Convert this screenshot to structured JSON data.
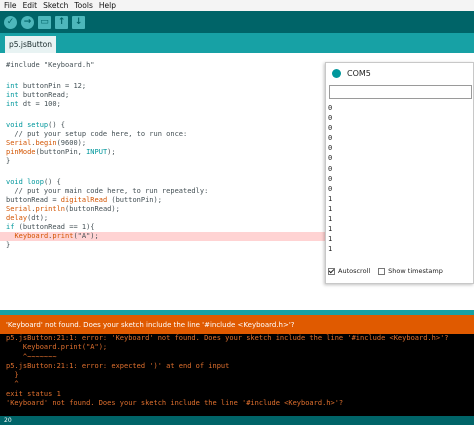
{
  "menu": [
    "File",
    "Edit",
    "Sketch",
    "Tools",
    "Help"
  ],
  "toolbar": {
    "verify": "✓",
    "upload": "→",
    "new": "▭",
    "open": "↑",
    "save": "↓"
  },
  "tab": {
    "label": "p5.jsButton"
  },
  "code": {
    "l1": "#include \"Keyboard.h\"",
    "l2_kw": "int",
    "l2": " buttonPin = 12;",
    "l3_kw": "int",
    "l3": " buttonRead;",
    "l4_kw": "int",
    "l4": " dt = 100;",
    "l5_kw": "void",
    "l5_fn": " setup",
    "l5": "() {",
    "l6": "  // put your setup code here, to run once:",
    "l7_fn": "Serial",
    "l7_a": ".",
    "l7_fn2": "begin",
    "l7": "(9600);",
    "l8_fn": "pinMode",
    "l8": "(buttonPin, ",
    "l8_kw": "INPUT",
    "l8_b": ");",
    "l9": "}",
    "l10_kw": "void",
    "l10_fn": " loop",
    "l10": "() {",
    "l11": "  // put your main code here, to run repeatedly:",
    "l12": "buttonRead = ",
    "l12_fn": "digitalRead",
    "l12_b": " (buttonPin);",
    "l13_fn": "Serial",
    "l13_a": ".",
    "l13_fn2": "println",
    "l13": "(buttonRead);",
    "l14_fn": "delay",
    "l14": "(dt);",
    "l15_kw": "if",
    "l15": " (buttonRead == 1){",
    "l16_fn": "Keyboard",
    "l16_a": ".",
    "l16_fn2": "print",
    "l16": "(\"A\");",
    "l17": "}"
  },
  "serial": {
    "title": "COM5",
    "input_value": "",
    "output": [
      "0",
      "0",
      "0",
      "0",
      "0",
      "0",
      "0",
      "0",
      "0",
      "1",
      "1",
      "1",
      "1",
      "1",
      "1"
    ],
    "autoscroll_label": "Autoscroll",
    "timestamp_label": "Show timestamp"
  },
  "error": {
    "message": "'Keyboard' not found. Does your sketch include the line '#include <Keyboard.h>'?"
  },
  "console": [
    "p5.jsButton:21:1: error: 'Keyboard' not found. Does your sketch include the line '#include <Keyboard.h>'?",
    "    Keyboard.print(\"A\");",
    "    ^~~~~~~~",
    "p5.jsButton:21:1: error: expected ')' at end of input",
    "  }",
    "  ^",
    "exit status 1",
    "'Keyboard' not found. Does your sketch include the line '#include <Keyboard.h>'?"
  ],
  "status": {
    "line": "20"
  }
}
